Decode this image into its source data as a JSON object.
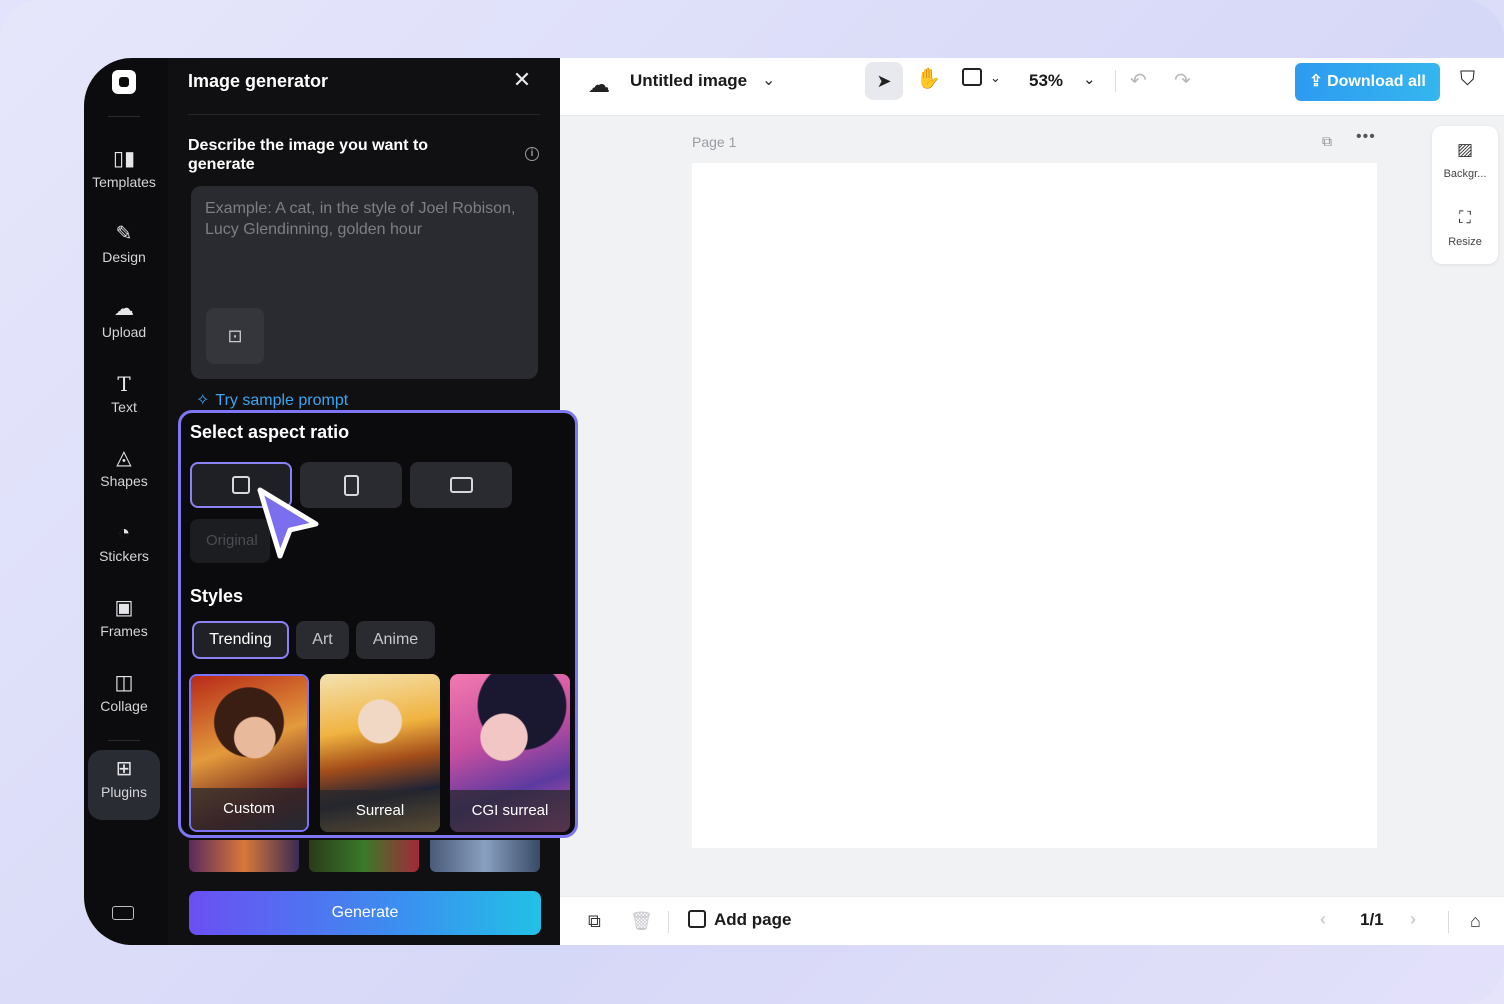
{
  "rail": {
    "items": [
      {
        "label": "Templates",
        "icon": "templates-icon"
      },
      {
        "label": "Design",
        "icon": "design-icon"
      },
      {
        "label": "Upload",
        "icon": "upload-icon"
      },
      {
        "label": "Text",
        "icon": "text-icon"
      },
      {
        "label": "Shapes",
        "icon": "shapes-icon"
      },
      {
        "label": "Stickers",
        "icon": "stickers-icon"
      },
      {
        "label": "Frames",
        "icon": "frames-icon"
      },
      {
        "label": "Collage",
        "icon": "collage-icon"
      },
      {
        "label": "Plugins",
        "icon": "plugins-icon"
      }
    ]
  },
  "panel": {
    "title": "Image generator",
    "describe_label": "Describe the image you want to generate",
    "prompt_placeholder": "Example: A cat, in the style of Joel Robison, Lucy Glendinning, golden hour",
    "try_sample": "Try sample prompt",
    "aspect_heading": "Select aspect ratio",
    "original_label": "Original",
    "styles_heading": "Styles",
    "style_tabs": [
      "Trending",
      "Art",
      "Anime"
    ],
    "style_cards": [
      "Custom",
      "Surreal",
      "CGI surreal"
    ],
    "generate_label": "Generate"
  },
  "topbar": {
    "doc_title": "Untitled image",
    "zoom": "53%",
    "download_label": "Download all"
  },
  "canvas": {
    "page_label": "Page 1"
  },
  "side_tools": {
    "background_label": "Backgr...",
    "resize_label": "Resize"
  },
  "bottombar": {
    "add_page_label": "Add page",
    "pager": "1/1"
  },
  "colors": {
    "accent": "#7f76f2",
    "download": "#35b6ef",
    "link": "#3aa6f0"
  }
}
